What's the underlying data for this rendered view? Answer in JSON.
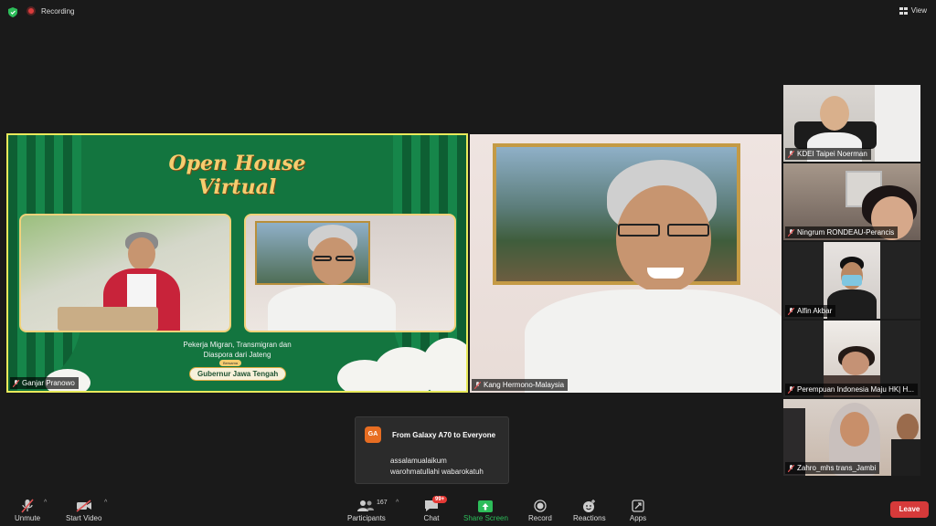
{
  "top": {
    "recording": "Recording",
    "view": "View"
  },
  "share": {
    "title_line1": "Open House",
    "title_line2": "Virtual",
    "subtitle_line1": "Pekerja Migran, Transmigran dan",
    "subtitle_line2": "Diaspora dari Jateng",
    "pill_small": "Bersama",
    "pill_main": "Gubernur Jawa Tengah",
    "name": "Ganjar Pranowo"
  },
  "speaker": {
    "name": "Kang Hermono-Malaysia"
  },
  "participants_side": [
    {
      "name": "KDEI Taipei Noerman"
    },
    {
      "name": "Ningrum RONDEAU-Perancis"
    },
    {
      "name": "Alfin Akbar"
    },
    {
      "name": "Perempuan Indonesia Maju HK| H..."
    },
    {
      "name": "Zahro_mhs trans_Jambi"
    }
  ],
  "chat_popup": {
    "avatar": "GA",
    "from": "From Galaxy A70 to Everyone",
    "line1": "assalamualaikum",
    "line2": "warohmatullahi wabarokatuh"
  },
  "toolbar": {
    "unmute": "Unmute",
    "start_video": "Start Video",
    "participants": "Participants",
    "participants_count": "167",
    "chat": "Chat",
    "chat_badge": "99+",
    "share_screen": "Share Screen",
    "record": "Record",
    "reactions": "Reactions",
    "apps": "Apps",
    "leave": "Leave"
  },
  "colors": {
    "share_border": "#e8ea5b",
    "share_green": "#13753f",
    "share_screen_green": "#2dbd5a",
    "leave_red": "#d63a3a",
    "badge_red": "#e53935",
    "muted_red": "#e05252"
  }
}
